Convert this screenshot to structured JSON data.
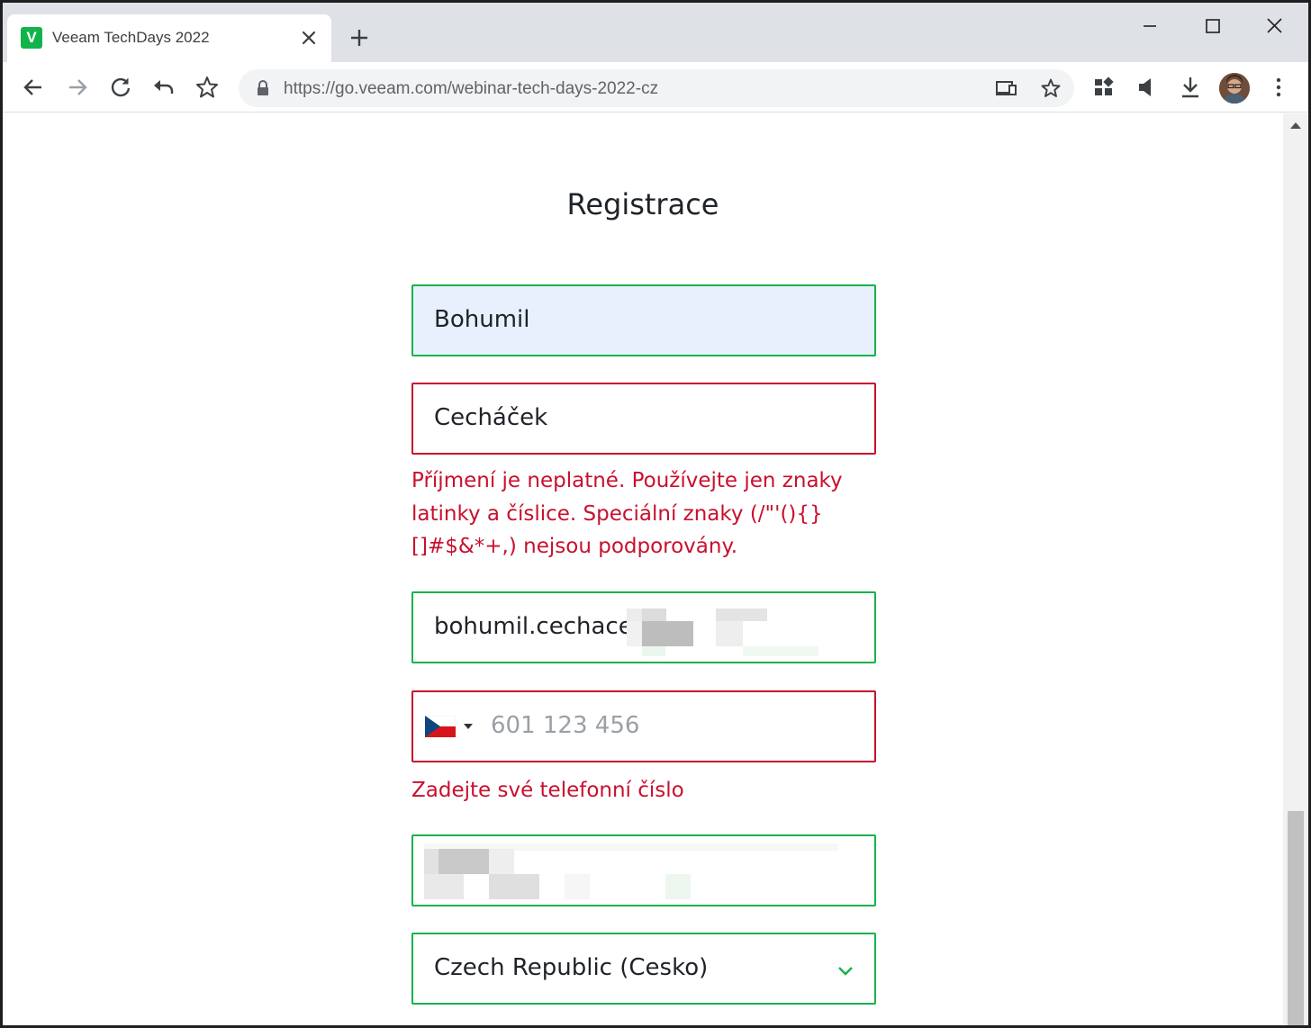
{
  "browser": {
    "tab_title": "Veeam TechDays 2022",
    "favicon_letter": "V",
    "url": "https://go.veeam.com/webinar-tech-days-2022-cz",
    "icons": [
      "back-icon",
      "forward-icon",
      "reload-icon",
      "undo-icon",
      "bookmark-star-icon",
      "lock-icon",
      "cast-icon",
      "star-icon",
      "extensions-icon",
      "speaker-icon",
      "download-icon",
      "avatar",
      "more-menu-icon"
    ],
    "accent_color": "#13b34b"
  },
  "form": {
    "title": "Registrace",
    "first_name": "Bohumil",
    "last_name": "Cecháček",
    "last_name_error": "Příjmení je neplatné. Používejte jen znaky latinky a číslice. Speciální znaky (/\"'(){}[]#$&*+,) nejsou podporovány.",
    "email": "bohumil.cechacek",
    "phone_placeholder": "601 123 456",
    "phone_country": "CZ",
    "phone_error": "Zadejte své telefonní číslo",
    "country_selected": "Czech Republic (Cesko)",
    "valid_color": "#13b34b",
    "error_color": "#c8102e"
  }
}
